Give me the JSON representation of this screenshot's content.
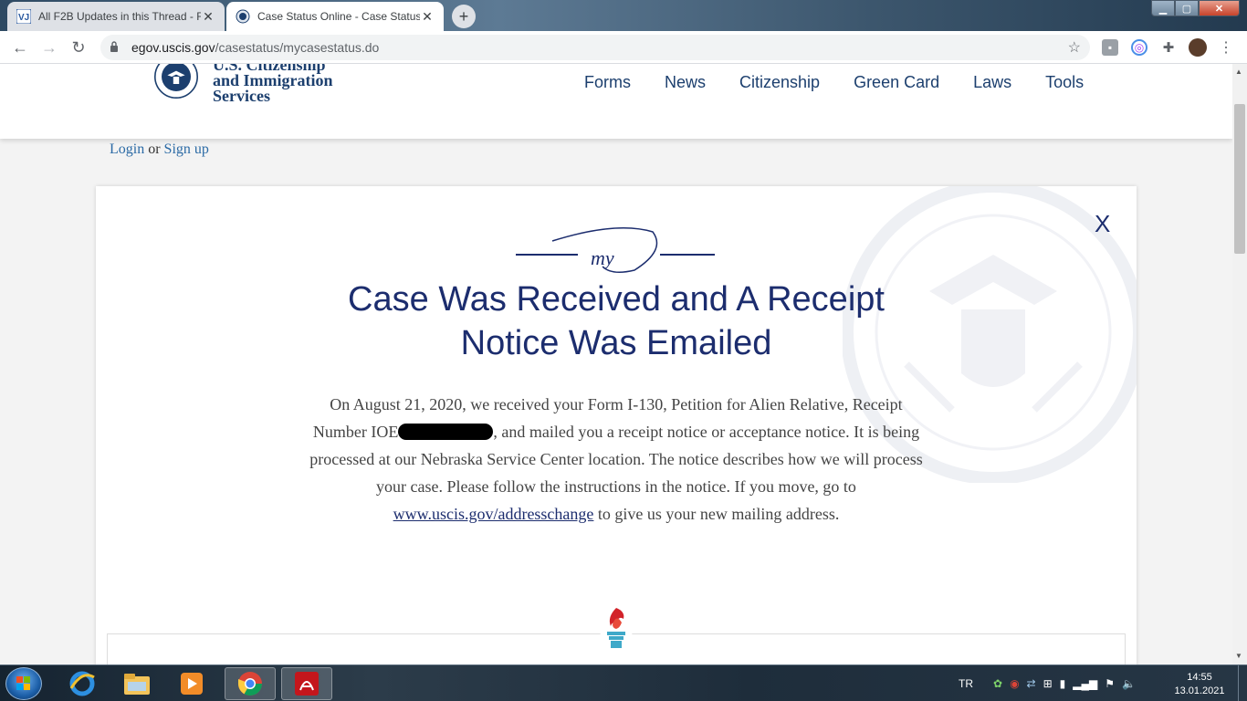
{
  "browser": {
    "tabs": [
      {
        "title": "All F2B Updates in this Thread - F",
        "favicon": "vj-icon",
        "active": false
      },
      {
        "title": "Case Status Online - Case Status",
        "favicon": "uscis-seal-icon",
        "active": true
      }
    ],
    "url_domain": "egov.uscis.gov",
    "url_path": "/casestatus/mycasestatus.do"
  },
  "site": {
    "logo_line1": "U.S. Citizenship",
    "logo_line2": "and Immigration",
    "logo_line3": "Services",
    "nav": [
      "Forms",
      "News",
      "Citizenship",
      "Green Card",
      "Laws",
      "Tools"
    ],
    "login_label": "Login",
    "or_label": "or",
    "signup_label": "Sign up"
  },
  "case": {
    "close_label": "X",
    "my_label": "my",
    "headline_line1": "Case Was Received and A Receipt",
    "headline_line2": "Notice Was Emailed",
    "body_part1": "On August 21, 2020, we received your Form I-130, Petition for Alien Relative, Receipt Number IOE",
    "body_part2": ", and mailed you a receipt notice or acceptance notice. It is being processed at our Nebraska Service Center location. The notice describes how we will process your case. Please follow the instructions in the notice. If you move, go to ",
    "body_link": "www.uscis.gov/addresschange",
    "body_part3": " to give us your new mailing address."
  },
  "taskbar": {
    "apps": [
      "internet-explorer-icon",
      "file-explorer-icon",
      "media-player-icon",
      "chrome-icon",
      "acrobat-icon"
    ],
    "language": "TR",
    "time": "14:55",
    "date": "13.01.2021"
  },
  "colors": {
    "headline": "#1c2d6e",
    "nav_text": "#1c3f6e",
    "link": "#2b6aa5",
    "body_text": "#444444"
  }
}
